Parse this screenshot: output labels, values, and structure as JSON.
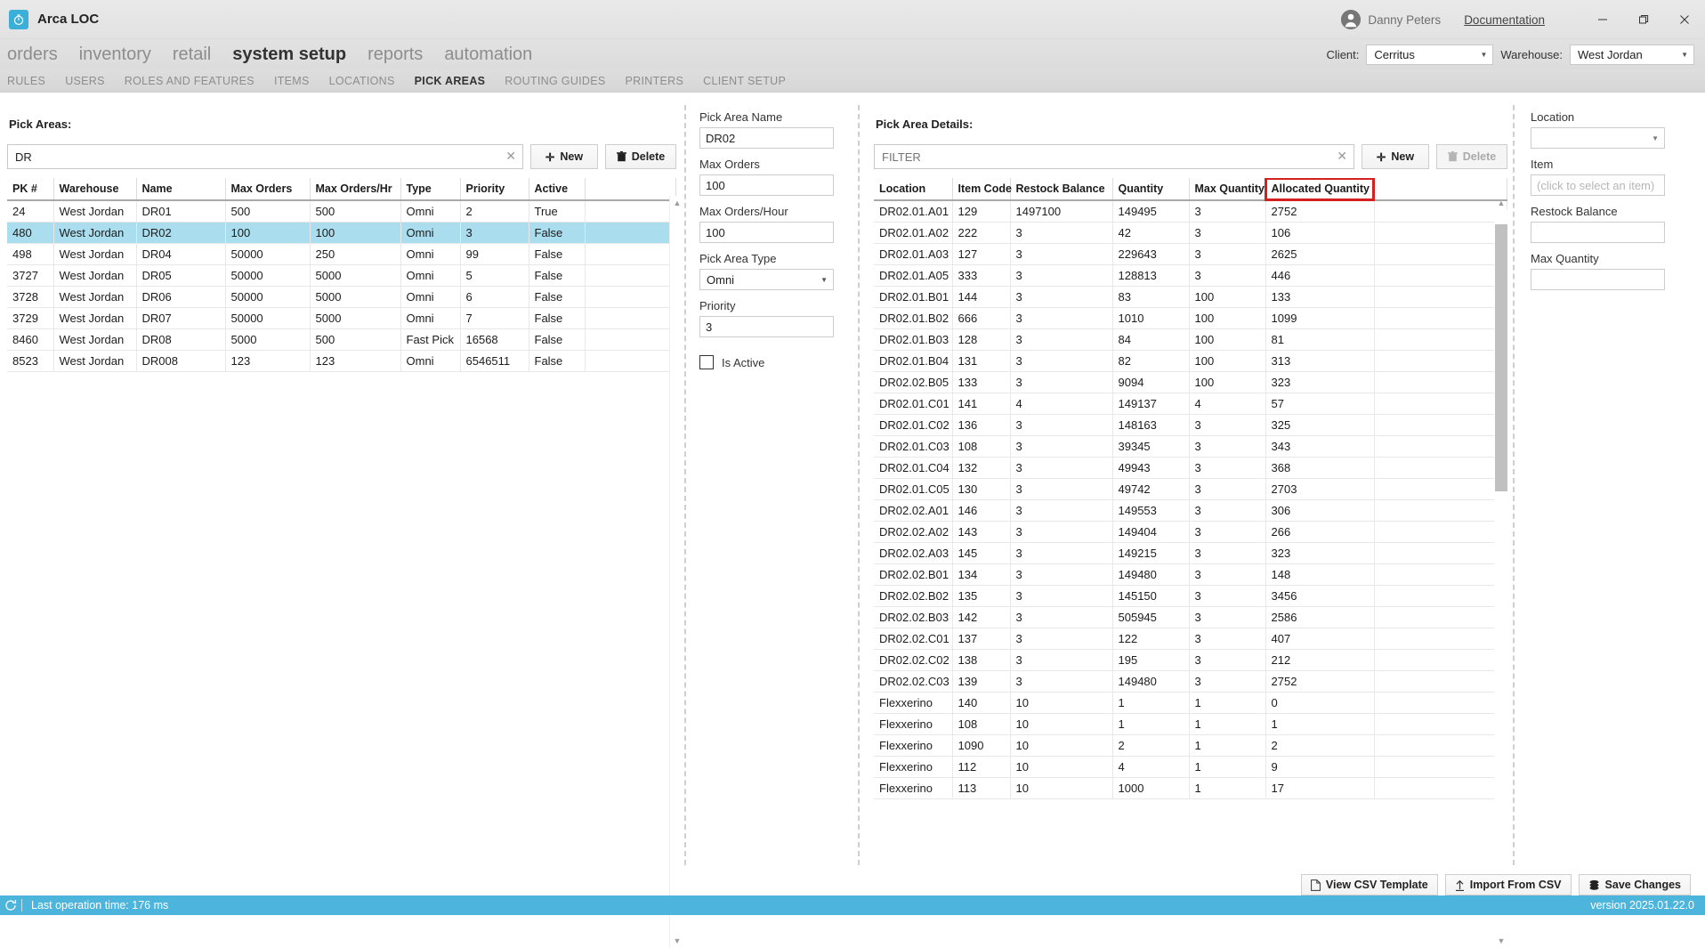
{
  "app": {
    "title": "Arca LOC",
    "logo_icon": "clock-icon",
    "user_name": "Danny Peters",
    "user_icon": "avatar-icon",
    "documentation_link": "Documentation",
    "window_buttons": [
      "minimize-icon",
      "restore-icon",
      "close-icon"
    ]
  },
  "mainnav": {
    "items": [
      {
        "label": "orders",
        "active": false
      },
      {
        "label": "inventory",
        "active": false
      },
      {
        "label": "retail",
        "active": false
      },
      {
        "label": "system setup",
        "active": true
      },
      {
        "label": "reports",
        "active": false
      },
      {
        "label": "automation",
        "active": false
      }
    ],
    "client_label": "Client:",
    "client_value": "Cerritus",
    "warehouse_label": "Warehouse:",
    "warehouse_value": "West Jordan"
  },
  "subnav": {
    "items": [
      {
        "label": "RULES",
        "active": false
      },
      {
        "label": "USERS",
        "active": false
      },
      {
        "label": "ROLES AND FEATURES",
        "active": false
      },
      {
        "label": "ITEMS",
        "active": false
      },
      {
        "label": "LOCATIONS",
        "active": false
      },
      {
        "label": "PICK AREAS",
        "active": true
      },
      {
        "label": "ROUTING GUIDES",
        "active": false
      },
      {
        "label": "PRINTERS",
        "active": false
      },
      {
        "label": "CLIENT SETUP",
        "active": false
      }
    ]
  },
  "pick_areas": {
    "heading": "Pick Areas:",
    "search_value": "DR",
    "search_placeholder": "",
    "clear_icon": "close-icon",
    "new_label": "New",
    "delete_label": "Delete",
    "columns": [
      "PK #",
      "Warehouse",
      "Name",
      "Max Orders",
      "Max Orders/Hr",
      "Type",
      "Priority",
      "Active"
    ],
    "rows": [
      {
        "pk": "24",
        "warehouse": "West Jordan",
        "name": "DR01",
        "max_orders": "500",
        "max_orders_hr": "500",
        "type": "Omni",
        "priority": "2",
        "active": "True",
        "selected": false
      },
      {
        "pk": "480",
        "warehouse": "West Jordan",
        "name": "DR02",
        "max_orders": "100",
        "max_orders_hr": "100",
        "type": "Omni",
        "priority": "3",
        "active": "False",
        "selected": true
      },
      {
        "pk": "498",
        "warehouse": "West Jordan",
        "name": "DR04",
        "max_orders": "50000",
        "max_orders_hr": "250",
        "type": "Omni",
        "priority": "99",
        "active": "False",
        "selected": false
      },
      {
        "pk": "3727",
        "warehouse": "West Jordan",
        "name": "DR05",
        "max_orders": "50000",
        "max_orders_hr": "5000",
        "type": "Omni",
        "priority": "5",
        "active": "False",
        "selected": false
      },
      {
        "pk": "3728",
        "warehouse": "West Jordan",
        "name": "DR06",
        "max_orders": "50000",
        "max_orders_hr": "5000",
        "type": "Omni",
        "priority": "6",
        "active": "False",
        "selected": false
      },
      {
        "pk": "3729",
        "warehouse": "West Jordan",
        "name": "DR07",
        "max_orders": "50000",
        "max_orders_hr": "5000",
        "type": "Omni",
        "priority": "7",
        "active": "False",
        "selected": false
      },
      {
        "pk": "8460",
        "warehouse": "West Jordan",
        "name": "DR08",
        "max_orders": "5000",
        "max_orders_hr": "500",
        "type": "Fast Pick",
        "priority": "16568",
        "active": "False",
        "selected": false
      },
      {
        "pk": "8523",
        "warehouse": "West Jordan",
        "name": "DR008",
        "max_orders": "123",
        "max_orders_hr": "123",
        "type": "Omni",
        "priority": "6546511",
        "active": "False",
        "selected": false
      }
    ]
  },
  "pick_area_form": {
    "name_label": "Pick Area Name",
    "name_value": "DR02",
    "max_orders_label": "Max Orders",
    "max_orders_value": "100",
    "max_orders_hour_label": "Max Orders/Hour",
    "max_orders_hour_value": "100",
    "type_label": "Pick Area Type",
    "type_value": "Omni",
    "priority_label": "Priority",
    "priority_value": "3",
    "is_active_label": "Is Active",
    "is_active_checked": false
  },
  "details": {
    "heading": "Pick Area Details:",
    "filter_value": "",
    "filter_placeholder": "FILTER",
    "clear_icon": "close-icon",
    "new_label": "New",
    "delete_label": "Delete",
    "delete_disabled": true,
    "highlight_color": "#d32020",
    "highlighted_column": "Allocated Quantity",
    "columns": [
      "Location",
      "Item Code",
      "Restock Balance",
      "Quantity",
      "Max Quantity",
      "Allocated Quantity"
    ],
    "rows": [
      {
        "location": "DR02.01.A01",
        "item_code": "129",
        "restock_balance": "1497100",
        "quantity": "149495",
        "max_quantity": "3",
        "allocated_quantity": "2752"
      },
      {
        "location": "DR02.01.A02",
        "item_code": "222",
        "restock_balance": "3",
        "quantity": "42",
        "max_quantity": "3",
        "allocated_quantity": "106"
      },
      {
        "location": "DR02.01.A03",
        "item_code": "127",
        "restock_balance": "3",
        "quantity": "229643",
        "max_quantity": "3",
        "allocated_quantity": "2625"
      },
      {
        "location": "DR02.01.A05",
        "item_code": "333",
        "restock_balance": "3",
        "quantity": "128813",
        "max_quantity": "3",
        "allocated_quantity": "446"
      },
      {
        "location": "DR02.01.B01",
        "item_code": "144",
        "restock_balance": "3",
        "quantity": "83",
        "max_quantity": "100",
        "allocated_quantity": "133"
      },
      {
        "location": "DR02.01.B02",
        "item_code": "666",
        "restock_balance": "3",
        "quantity": "1010",
        "max_quantity": "100",
        "allocated_quantity": "1099"
      },
      {
        "location": "DR02.01.B03",
        "item_code": "128",
        "restock_balance": "3",
        "quantity": "84",
        "max_quantity": "100",
        "allocated_quantity": "81"
      },
      {
        "location": "DR02.01.B04",
        "item_code": "131",
        "restock_balance": "3",
        "quantity": "82",
        "max_quantity": "100",
        "allocated_quantity": "313"
      },
      {
        "location": "DR02.02.B05",
        "item_code": "133",
        "restock_balance": "3",
        "quantity": "9094",
        "max_quantity": "100",
        "allocated_quantity": "323"
      },
      {
        "location": "DR02.01.C01",
        "item_code": "141",
        "restock_balance": "4",
        "quantity": "149137",
        "max_quantity": "4",
        "allocated_quantity": "57"
      },
      {
        "location": "DR02.01.C02",
        "item_code": "136",
        "restock_balance": "3",
        "quantity": "148163",
        "max_quantity": "3",
        "allocated_quantity": "325"
      },
      {
        "location": "DR02.01.C03",
        "item_code": "108",
        "restock_balance": "3",
        "quantity": "39345",
        "max_quantity": "3",
        "allocated_quantity": "343"
      },
      {
        "location": "DR02.01.C04",
        "item_code": "132",
        "restock_balance": "3",
        "quantity": "49943",
        "max_quantity": "3",
        "allocated_quantity": "368"
      },
      {
        "location": "DR02.01.C05",
        "item_code": "130",
        "restock_balance": "3",
        "quantity": "49742",
        "max_quantity": "3",
        "allocated_quantity": "2703"
      },
      {
        "location": "DR02.02.A01",
        "item_code": "146",
        "restock_balance": "3",
        "quantity": "149553",
        "max_quantity": "3",
        "allocated_quantity": "306"
      },
      {
        "location": "DR02.02.A02",
        "item_code": "143",
        "restock_balance": "3",
        "quantity": "149404",
        "max_quantity": "3",
        "allocated_quantity": "266"
      },
      {
        "location": "DR02.02.A03",
        "item_code": "145",
        "restock_balance": "3",
        "quantity": "149215",
        "max_quantity": "3",
        "allocated_quantity": "323"
      },
      {
        "location": "DR02.02.B01",
        "item_code": "134",
        "restock_balance": "3",
        "quantity": "149480",
        "max_quantity": "3",
        "allocated_quantity": "148"
      },
      {
        "location": "DR02.02.B02",
        "item_code": "135",
        "restock_balance": "3",
        "quantity": "145150",
        "max_quantity": "3",
        "allocated_quantity": "3456"
      },
      {
        "location": "DR02.02.B03",
        "item_code": "142",
        "restock_balance": "3",
        "quantity": "505945",
        "max_quantity": "3",
        "allocated_quantity": "2586"
      },
      {
        "location": "DR02.02.C01",
        "item_code": "137",
        "restock_balance": "3",
        "quantity": "122",
        "max_quantity": "3",
        "allocated_quantity": "407"
      },
      {
        "location": "DR02.02.C02",
        "item_code": "138",
        "restock_balance": "3",
        "quantity": "195",
        "max_quantity": "3",
        "allocated_quantity": "212"
      },
      {
        "location": "DR02.02.C03",
        "item_code": "139",
        "restock_balance": "3",
        "quantity": "149480",
        "max_quantity": "3",
        "allocated_quantity": "2752"
      },
      {
        "location": "Flexxerino",
        "item_code": "140",
        "restock_balance": "10",
        "quantity": "1",
        "max_quantity": "1",
        "allocated_quantity": "0"
      },
      {
        "location": "Flexxerino",
        "item_code": "108",
        "restock_balance": "10",
        "quantity": "1",
        "max_quantity": "1",
        "allocated_quantity": "1"
      },
      {
        "location": "Flexxerino",
        "item_code": "1090",
        "restock_balance": "10",
        "quantity": "2",
        "max_quantity": "1",
        "allocated_quantity": "2"
      },
      {
        "location": "Flexxerino",
        "item_code": "112",
        "restock_balance": "10",
        "quantity": "4",
        "max_quantity": "1",
        "allocated_quantity": "9"
      },
      {
        "location": "Flexxerino",
        "item_code": "113",
        "restock_balance": "10",
        "quantity": "1000",
        "max_quantity": "1",
        "allocated_quantity": "17"
      }
    ]
  },
  "detail_form": {
    "location_label": "Location",
    "location_value": "",
    "item_label": "Item",
    "item_value": "",
    "item_placeholder": "(click to select an item)",
    "restock_balance_label": "Restock Balance",
    "restock_balance_value": "",
    "max_quantity_label": "Max Quantity",
    "max_quantity_value": ""
  },
  "footer": {
    "view_csv_label": "View CSV Template",
    "import_csv_label": "Import From CSV",
    "save_label": "Save Changes",
    "status_text": "Last operation time:  176 ms",
    "version": "version 2025.01.22.0",
    "status_color": "#4db4dc",
    "refresh_icon": "refresh-icon"
  }
}
